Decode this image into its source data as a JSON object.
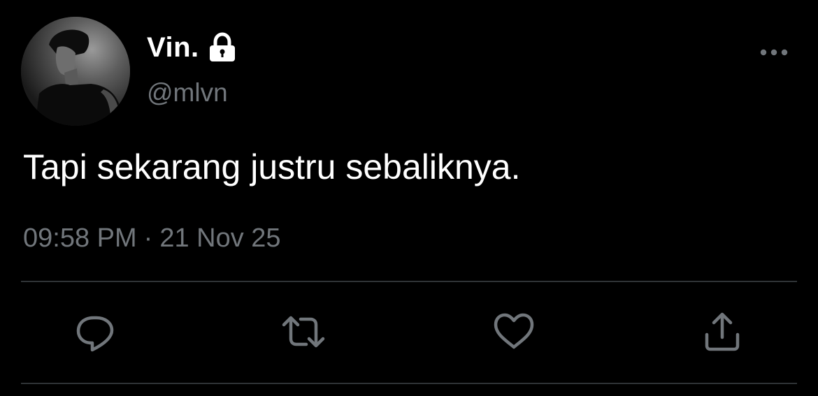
{
  "tweet": {
    "author": {
      "display_name": "Vin.",
      "handle": "@mlvn",
      "protected_icon": "lock-icon",
      "avatar": "profile-photo"
    },
    "text": "Tapi sekarang justru sebaliknya.",
    "time": "09:58 PM",
    "separator": "·",
    "date": "21 Nov 25",
    "more_icon": "more-horizontal-icon"
  },
  "actions": [
    {
      "name": "reply",
      "icon": "reply-bubble-icon"
    },
    {
      "name": "retweet",
      "icon": "retweet-icon"
    },
    {
      "name": "like",
      "icon": "heart-icon"
    },
    {
      "name": "share",
      "icon": "share-upload-icon"
    }
  ],
  "colors": {
    "background": "#000000",
    "primary_text": "#ffffff",
    "secondary_text": "#71767b",
    "divider": "#2f3336"
  }
}
